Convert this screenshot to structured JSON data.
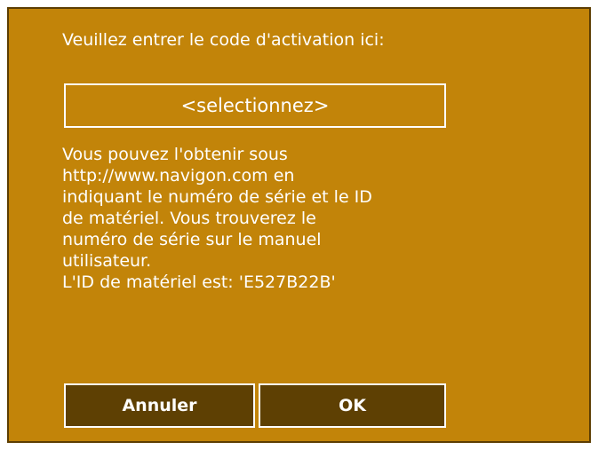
{
  "dialog": {
    "prompt": "Veuillez entrer le code d'activation ici:",
    "code_field": {
      "value": "<selectionnez>"
    },
    "info_lines": [
      "Vous pouvez l'obtenir sous",
      "http://www.navigon.com en",
      "indiquant le numéro de série et le ID",
      "de matériel. Vous trouverez le",
      "numéro de série sur le manuel",
      "utilisateur.",
      "L'ID de matériel est: 'E527B22B'"
    ],
    "buttons": {
      "cancel_label": "Annuler",
      "ok_label": "OK"
    }
  },
  "colors": {
    "background": "#c28409",
    "button": "#5e4003",
    "border": "#ffffff",
    "frame": "#5c3d02"
  }
}
